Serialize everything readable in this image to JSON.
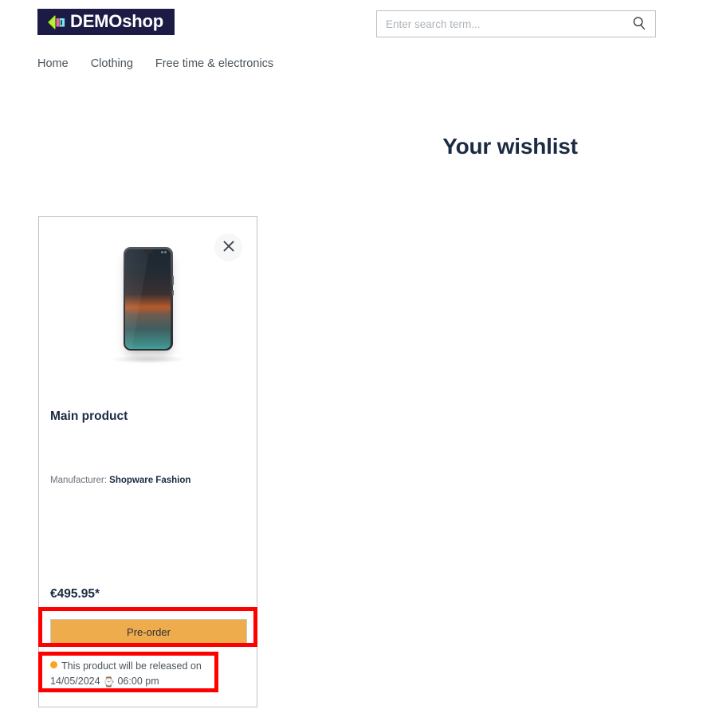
{
  "header": {
    "logo": {
      "text": "DEMOshop",
      "mark_icon": "chevron-left-block-logo-icon",
      "background": "#1b1b45"
    },
    "search": {
      "placeholder": "Enter search term...",
      "value": "",
      "icon": "search-icon"
    }
  },
  "nav": {
    "items": [
      {
        "label": "Home"
      },
      {
        "label": "Clothing"
      },
      {
        "label": "Free time & electronics"
      }
    ]
  },
  "main": {
    "title": "Your wishlist"
  },
  "product": {
    "image_alt": "smartphone-product-image",
    "remove_icon": "close-icon",
    "name": "Main product",
    "manufacturer_label": "Manufacturer:",
    "manufacturer_value": "Shopware Fashion",
    "price": "€495.95*",
    "preorder_label": "Pre-order",
    "release_status_icon": "orange-dot-status-icon",
    "release_text_line1": "This product will be released on",
    "release_date": "14/05/2024",
    "release_clock_icon": "⌚",
    "release_time": "06:00 pm"
  },
  "colors": {
    "logo_bg": "#1b1b45",
    "heading": "#1b2b42",
    "preorder_button": "#eeac4d",
    "status_dot": "#f5a623",
    "annotation": "#fe0000",
    "border": "#bcc1c7"
  }
}
